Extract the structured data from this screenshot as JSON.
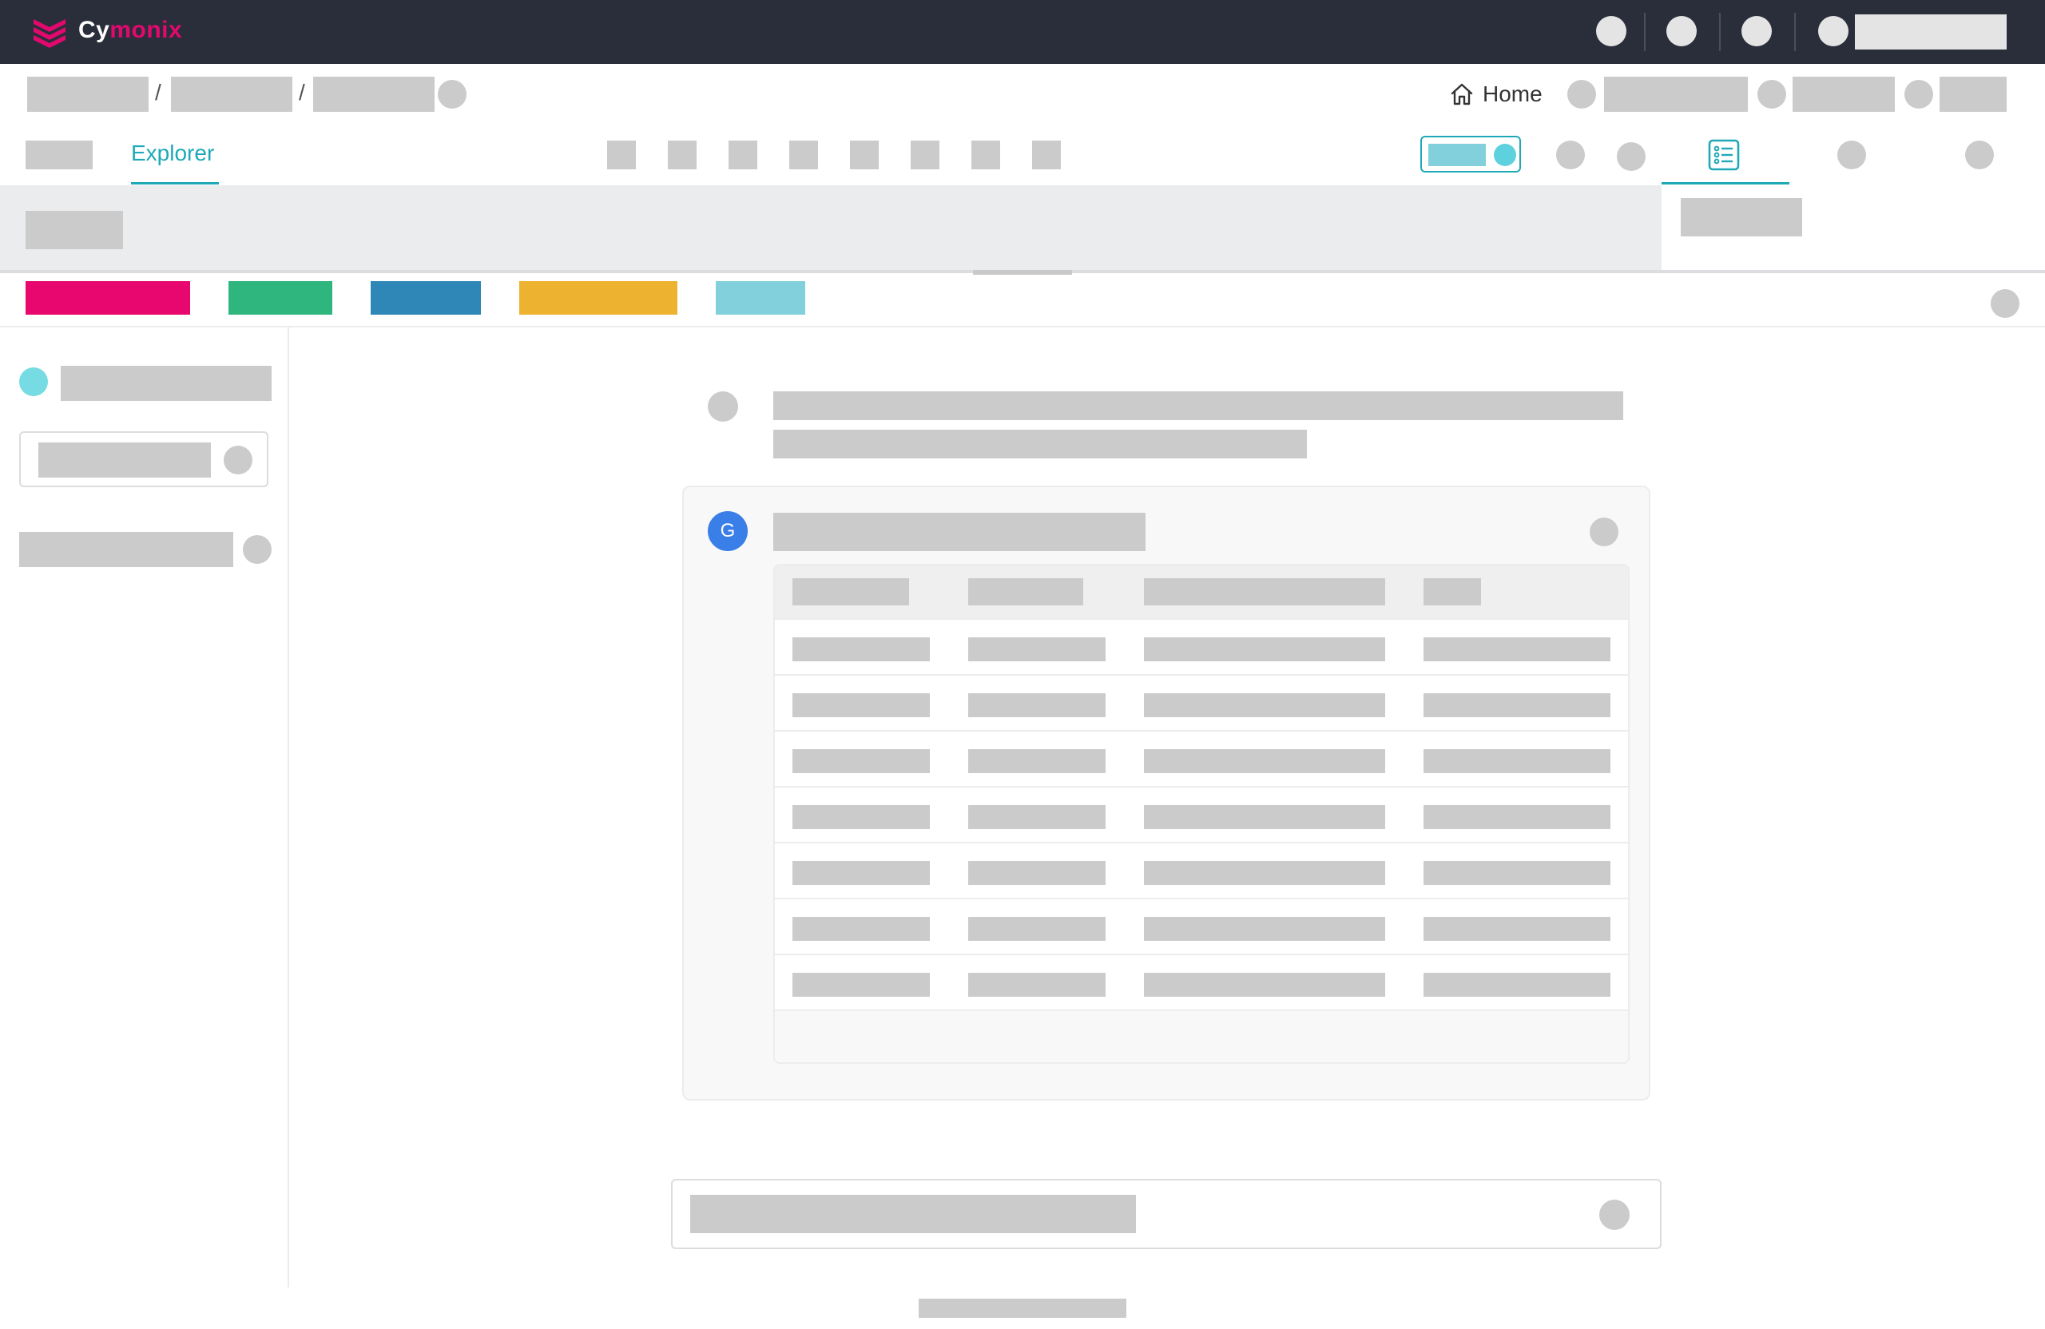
{
  "app": {
    "logo_prefix": "Cy",
    "logo_accent": "monix",
    "brand_color": "#e2086e",
    "accent_color": "#1fa9b8"
  },
  "breadcrumb": {
    "separator": "/",
    "home_label": "Home"
  },
  "tabs": {
    "explorer_label": "Explorer"
  },
  "chips": [
    {
      "color": "#e8076e"
    },
    {
      "color": "#2fb67e"
    },
    {
      "color": "#2e87b7"
    },
    {
      "color": "#edb22f"
    },
    {
      "color": "#82d0dc"
    }
  ],
  "chat": {
    "avatar_letter": "G",
    "table": {
      "columns": 4,
      "rows": 7
    }
  },
  "icons": {
    "home": "home-icon",
    "panel_tab": "list-panel-icon"
  }
}
